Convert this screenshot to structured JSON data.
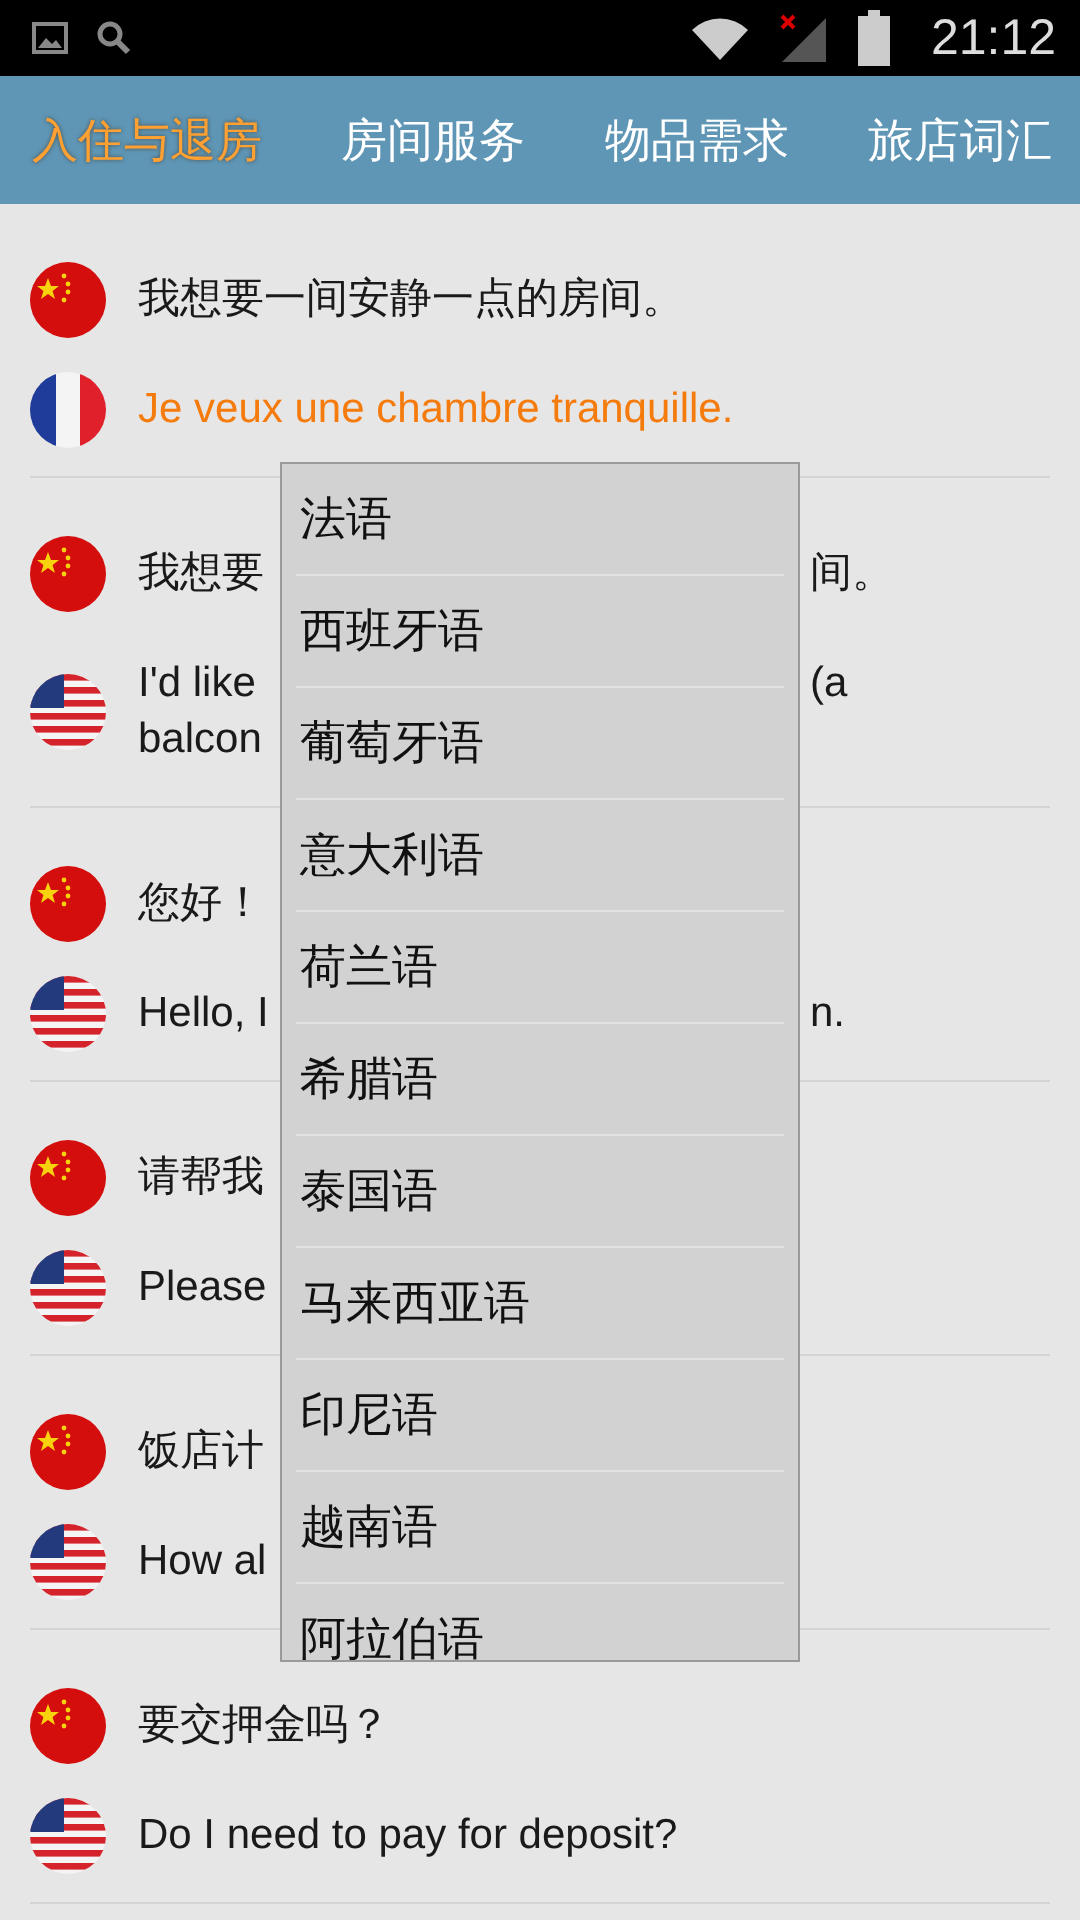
{
  "status_bar": {
    "time": "21:12"
  },
  "tabs": [
    {
      "label": "入住与退房",
      "selected": true
    },
    {
      "label": "房间服务",
      "selected": false
    },
    {
      "label": "物品需求",
      "selected": false
    },
    {
      "label": "旅店词汇",
      "selected": false
    }
  ],
  "phrases": [
    {
      "entries": [
        {
          "kind": "cn",
          "highlighted": false,
          "lines": [
            {
              "left": "我想要一间安静一点的房间。"
            }
          ]
        },
        {
          "kind": "fr",
          "highlighted": true,
          "lines": [
            {
              "left": "Je veux une chambre tranquille."
            }
          ]
        }
      ]
    },
    {
      "entries": [
        {
          "kind": "cn",
          "highlighted": false,
          "lines": [
            {
              "left": "我想要",
              "right": "间。"
            }
          ]
        },
        {
          "kind": "us",
          "highlighted": false,
          "lines": [
            {
              "left": "I'd like",
              "right": "(a"
            },
            {
              "left": "balcon"
            }
          ]
        }
      ]
    },
    {
      "entries": [
        {
          "kind": "cn",
          "highlighted": false,
          "lines": [
            {
              "left": "您好！"
            }
          ]
        },
        {
          "kind": "us",
          "highlighted": false,
          "lines": [
            {
              "left": "Hello, I",
              "right": "n."
            }
          ]
        }
      ]
    },
    {
      "entries": [
        {
          "kind": "cn",
          "highlighted": false,
          "lines": [
            {
              "left": "请帮我"
            }
          ]
        },
        {
          "kind": "us",
          "highlighted": false,
          "lines": [
            {
              "left": "Please"
            }
          ]
        }
      ]
    },
    {
      "entries": [
        {
          "kind": "cn",
          "highlighted": false,
          "lines": [
            {
              "left": "饭店计"
            }
          ]
        },
        {
          "kind": "us",
          "highlighted": false,
          "lines": [
            {
              "left": "How al"
            }
          ]
        }
      ]
    },
    {
      "entries": [
        {
          "kind": "cn",
          "highlighted": false,
          "lines": [
            {
              "left": "要交押金吗？"
            }
          ]
        },
        {
          "kind": "us",
          "highlighted": false,
          "lines": [
            {
              "left": "Do I need to pay for deposit?"
            }
          ]
        }
      ]
    }
  ],
  "language_menu": {
    "items": [
      "法语",
      "西班牙语",
      "葡萄牙语",
      "意大利语",
      "荷兰语",
      "希腊语",
      "泰国语",
      "马来西亚语",
      "印尼语",
      "越南语",
      "阿拉伯语"
    ]
  }
}
